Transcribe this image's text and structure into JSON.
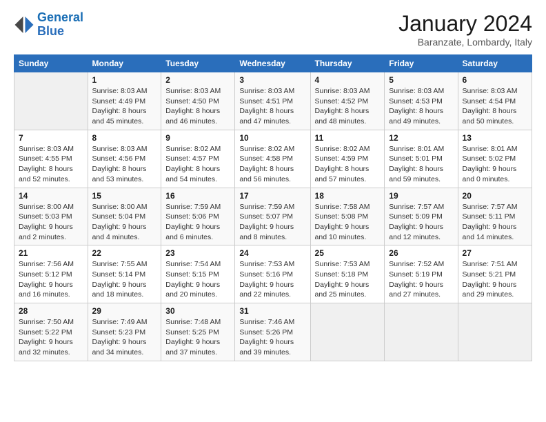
{
  "logo": {
    "line1": "General",
    "line2": "Blue"
  },
  "header": {
    "title": "January 2024",
    "subtitle": "Baranzate, Lombardy, Italy"
  },
  "days_of_week": [
    "Sunday",
    "Monday",
    "Tuesday",
    "Wednesday",
    "Thursday",
    "Friday",
    "Saturday"
  ],
  "weeks": [
    [
      {
        "day": "",
        "info": ""
      },
      {
        "day": "1",
        "info": "Sunrise: 8:03 AM\nSunset: 4:49 PM\nDaylight: 8 hours\nand 45 minutes."
      },
      {
        "day": "2",
        "info": "Sunrise: 8:03 AM\nSunset: 4:50 PM\nDaylight: 8 hours\nand 46 minutes."
      },
      {
        "day": "3",
        "info": "Sunrise: 8:03 AM\nSunset: 4:51 PM\nDaylight: 8 hours\nand 47 minutes."
      },
      {
        "day": "4",
        "info": "Sunrise: 8:03 AM\nSunset: 4:52 PM\nDaylight: 8 hours\nand 48 minutes."
      },
      {
        "day": "5",
        "info": "Sunrise: 8:03 AM\nSunset: 4:53 PM\nDaylight: 8 hours\nand 49 minutes."
      },
      {
        "day": "6",
        "info": "Sunrise: 8:03 AM\nSunset: 4:54 PM\nDaylight: 8 hours\nand 50 minutes."
      }
    ],
    [
      {
        "day": "7",
        "info": "Sunrise: 8:03 AM\nSunset: 4:55 PM\nDaylight: 8 hours\nand 52 minutes."
      },
      {
        "day": "8",
        "info": "Sunrise: 8:03 AM\nSunset: 4:56 PM\nDaylight: 8 hours\nand 53 minutes."
      },
      {
        "day": "9",
        "info": "Sunrise: 8:02 AM\nSunset: 4:57 PM\nDaylight: 8 hours\nand 54 minutes."
      },
      {
        "day": "10",
        "info": "Sunrise: 8:02 AM\nSunset: 4:58 PM\nDaylight: 8 hours\nand 56 minutes."
      },
      {
        "day": "11",
        "info": "Sunrise: 8:02 AM\nSunset: 4:59 PM\nDaylight: 8 hours\nand 57 minutes."
      },
      {
        "day": "12",
        "info": "Sunrise: 8:01 AM\nSunset: 5:01 PM\nDaylight: 8 hours\nand 59 minutes."
      },
      {
        "day": "13",
        "info": "Sunrise: 8:01 AM\nSunset: 5:02 PM\nDaylight: 9 hours\nand 0 minutes."
      }
    ],
    [
      {
        "day": "14",
        "info": "Sunrise: 8:00 AM\nSunset: 5:03 PM\nDaylight: 9 hours\nand 2 minutes."
      },
      {
        "day": "15",
        "info": "Sunrise: 8:00 AM\nSunset: 5:04 PM\nDaylight: 9 hours\nand 4 minutes."
      },
      {
        "day": "16",
        "info": "Sunrise: 7:59 AM\nSunset: 5:06 PM\nDaylight: 9 hours\nand 6 minutes."
      },
      {
        "day": "17",
        "info": "Sunrise: 7:59 AM\nSunset: 5:07 PM\nDaylight: 9 hours\nand 8 minutes."
      },
      {
        "day": "18",
        "info": "Sunrise: 7:58 AM\nSunset: 5:08 PM\nDaylight: 9 hours\nand 10 minutes."
      },
      {
        "day": "19",
        "info": "Sunrise: 7:57 AM\nSunset: 5:09 PM\nDaylight: 9 hours\nand 12 minutes."
      },
      {
        "day": "20",
        "info": "Sunrise: 7:57 AM\nSunset: 5:11 PM\nDaylight: 9 hours\nand 14 minutes."
      }
    ],
    [
      {
        "day": "21",
        "info": "Sunrise: 7:56 AM\nSunset: 5:12 PM\nDaylight: 9 hours\nand 16 minutes."
      },
      {
        "day": "22",
        "info": "Sunrise: 7:55 AM\nSunset: 5:14 PM\nDaylight: 9 hours\nand 18 minutes."
      },
      {
        "day": "23",
        "info": "Sunrise: 7:54 AM\nSunset: 5:15 PM\nDaylight: 9 hours\nand 20 minutes."
      },
      {
        "day": "24",
        "info": "Sunrise: 7:53 AM\nSunset: 5:16 PM\nDaylight: 9 hours\nand 22 minutes."
      },
      {
        "day": "25",
        "info": "Sunrise: 7:53 AM\nSunset: 5:18 PM\nDaylight: 9 hours\nand 25 minutes."
      },
      {
        "day": "26",
        "info": "Sunrise: 7:52 AM\nSunset: 5:19 PM\nDaylight: 9 hours\nand 27 minutes."
      },
      {
        "day": "27",
        "info": "Sunrise: 7:51 AM\nSunset: 5:21 PM\nDaylight: 9 hours\nand 29 minutes."
      }
    ],
    [
      {
        "day": "28",
        "info": "Sunrise: 7:50 AM\nSunset: 5:22 PM\nDaylight: 9 hours\nand 32 minutes."
      },
      {
        "day": "29",
        "info": "Sunrise: 7:49 AM\nSunset: 5:23 PM\nDaylight: 9 hours\nand 34 minutes."
      },
      {
        "day": "30",
        "info": "Sunrise: 7:48 AM\nSunset: 5:25 PM\nDaylight: 9 hours\nand 37 minutes."
      },
      {
        "day": "31",
        "info": "Sunrise: 7:46 AM\nSunset: 5:26 PM\nDaylight: 9 hours\nand 39 minutes."
      },
      {
        "day": "",
        "info": ""
      },
      {
        "day": "",
        "info": ""
      },
      {
        "day": "",
        "info": ""
      }
    ]
  ]
}
